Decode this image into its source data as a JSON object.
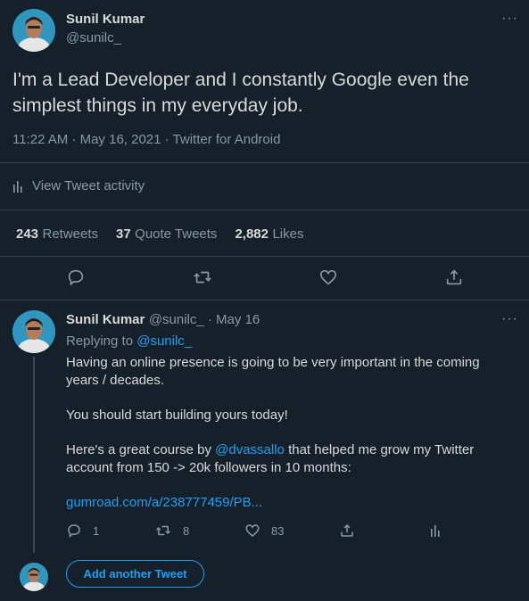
{
  "main_tweet": {
    "author_name": "Sunil Kumar",
    "handle": "@sunilc_",
    "more": "···",
    "text_line1": "I'm a Lead Developer and I constantly Google even the",
    "text_line2": "simplest things in my everyday job.",
    "meta": "11:22 AM · May 16, 2021 · Twitter for Android",
    "activity_label": "View Tweet activity",
    "stats": {
      "retweets_count": "243",
      "retweets_label": "Retweets",
      "quotes_count": "37",
      "quotes_label": "Quote Tweets",
      "likes_count": "2,882",
      "likes_label": "Likes"
    }
  },
  "reply_tweet": {
    "author_name": "Sunil Kumar",
    "handle_date": "@sunilc_ · May 16",
    "more": "···",
    "replying_prefix": "Replying to",
    "replying_handle": "@sunilc_",
    "line1": "Having an online presence is going to be very important in the coming",
    "line2": "years / decades.",
    "line3": "You should start building yours today!",
    "line4_pre": "Here's a great course by",
    "line4_mention": "@dvassallo",
    "line4_post": "that helped me grow my Twitter",
    "line5": "account from 150 -> 20k followers in 10 months:",
    "link": "gumroad.com/a/238777459/PB...",
    "reply_count": "1",
    "retweet_count": "8",
    "like_count": "83"
  },
  "composer": {
    "add_button_label": "Add another Tweet"
  },
  "icons": {
    "reply": "reply-icon",
    "retweet": "retweet-icon",
    "like": "heart-icon",
    "share": "share-icon",
    "analytics": "analytics-icon"
  },
  "colors": {
    "background": "#15202b",
    "accent": "#1da1f2",
    "text": "#d9d9d9",
    "muted": "#8899a6",
    "divider": "#38444d"
  }
}
